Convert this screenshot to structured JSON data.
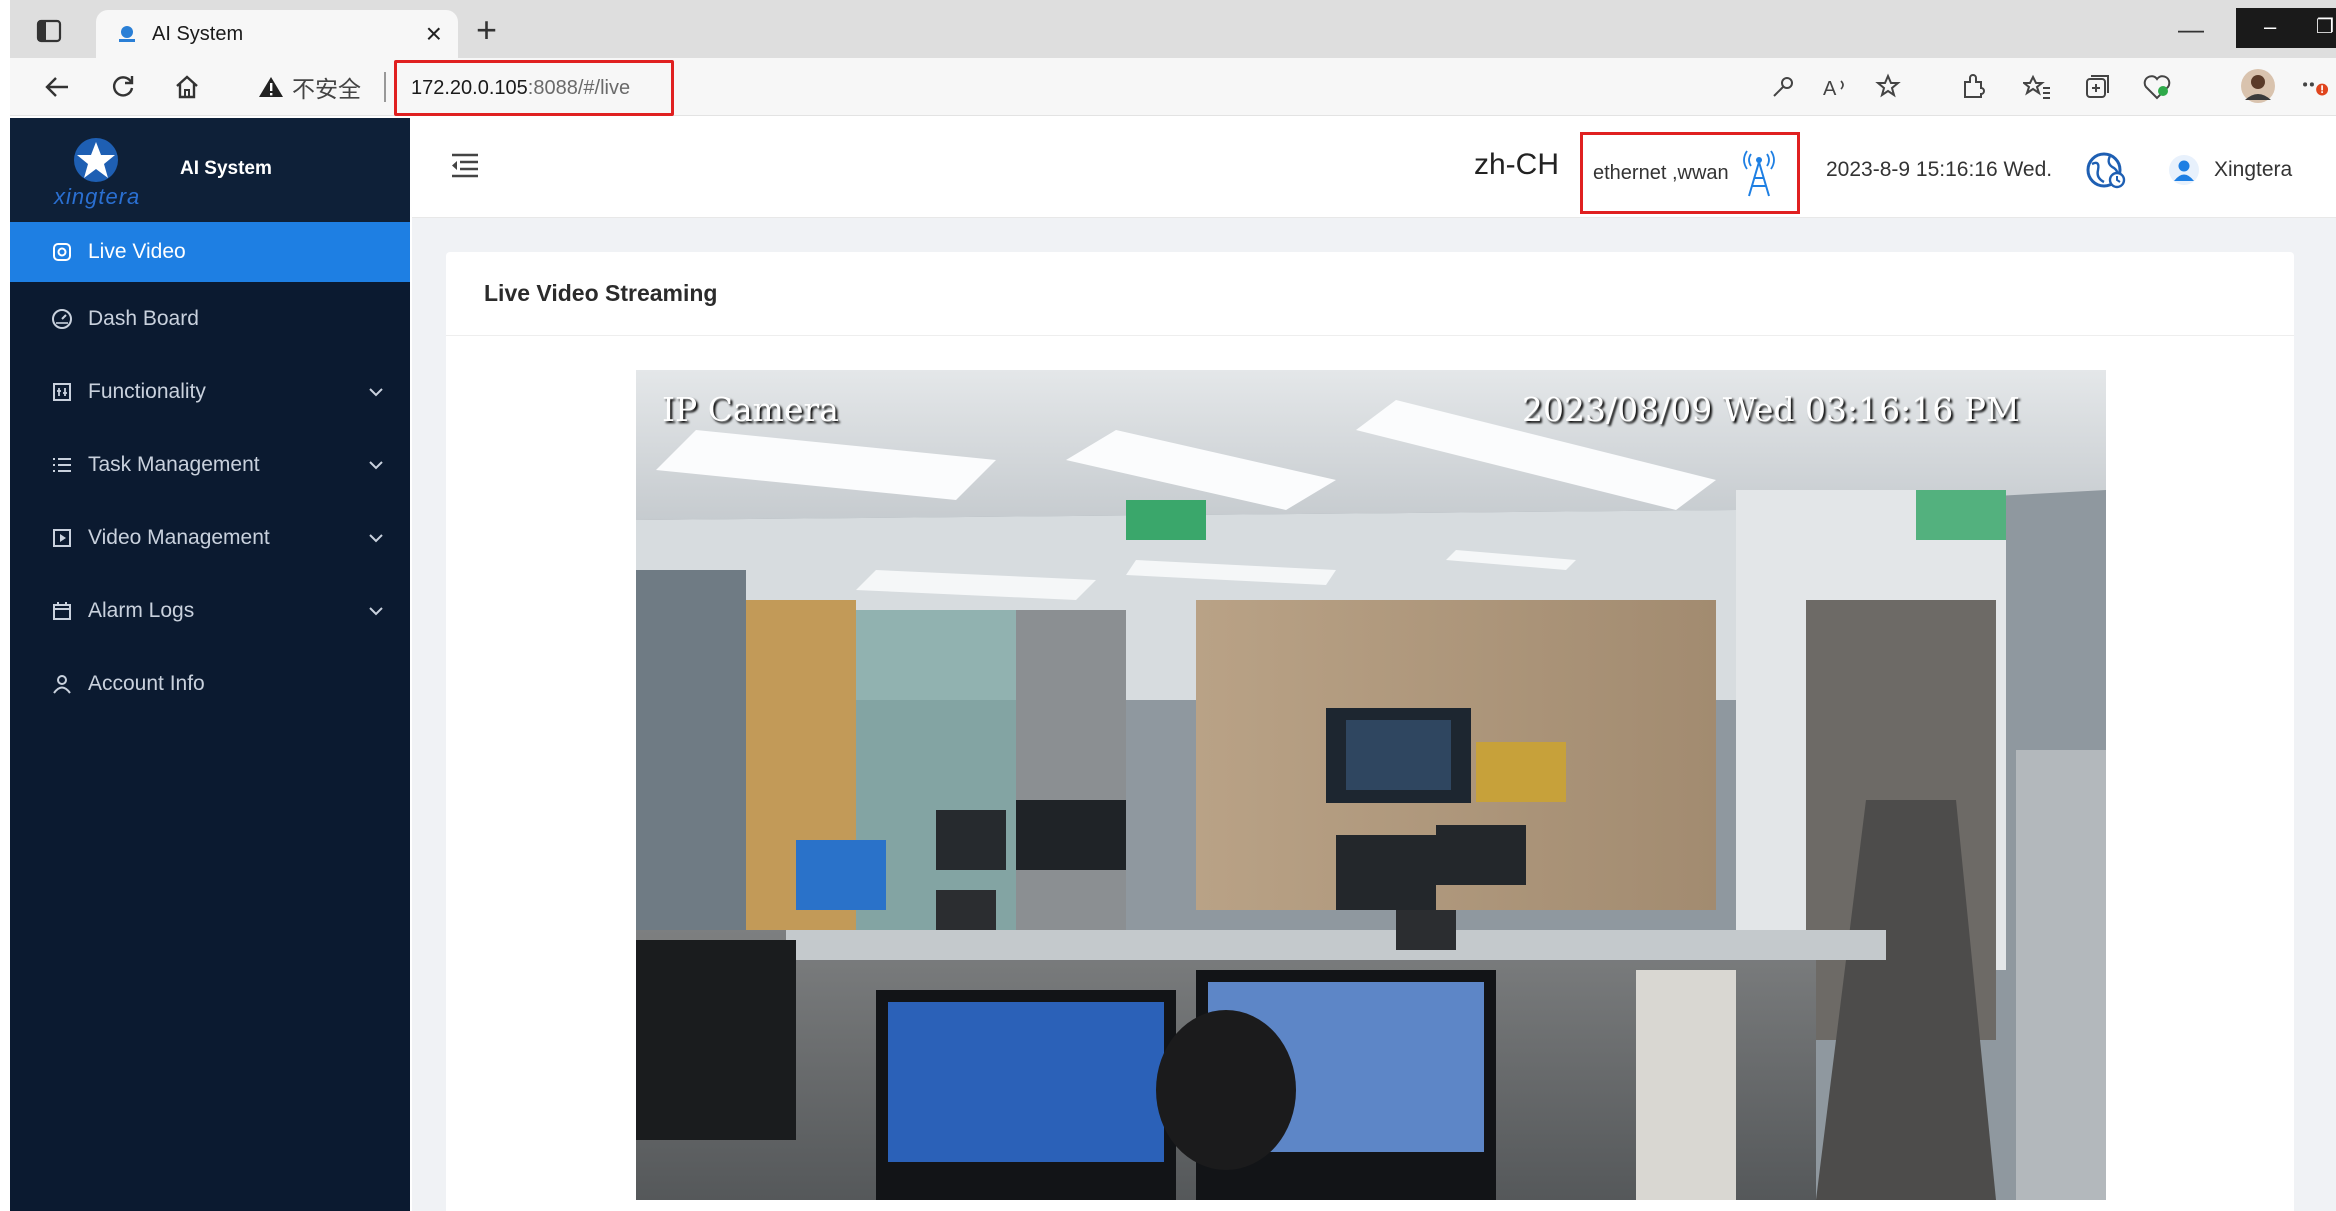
{
  "browser": {
    "tab_title": "AI System",
    "new_tab": "+",
    "close": "×",
    "security_warning": "不安全",
    "url_host": "172.20.0.105",
    "url_rest": ":8088/#/live"
  },
  "app": {
    "logo_text": "xingtera",
    "title": "AI System"
  },
  "menu": {
    "items": [
      {
        "label": "Live Video",
        "icon": "camera-icon",
        "active": true
      },
      {
        "label": "Dash Board",
        "icon": "dashboard-icon",
        "has_children": false
      },
      {
        "label": "Functionality",
        "icon": "functionality-icon",
        "has_children": true
      },
      {
        "label": "Task Management",
        "icon": "list-icon",
        "has_children": true
      },
      {
        "label": "Video Management",
        "icon": "video-icon",
        "has_children": true
      },
      {
        "label": "Alarm Logs",
        "icon": "calendar-icon",
        "has_children": true
      },
      {
        "label": "Account Info",
        "icon": "user-icon",
        "has_children": false
      }
    ]
  },
  "header": {
    "language": "zh-CH",
    "network": "ethernet ,wwan",
    "datetime": "2023-8-9 15:16:16 Wed.",
    "username": "Xingtera"
  },
  "content": {
    "title": "Live Video Streaming",
    "video_label_left": "IP Camera",
    "video_timestamp": "2023/08/09 Wed 03:16:16 PM"
  },
  "colors": {
    "sidebar_bg": "#0b1a30",
    "active_item": "#1e7fe3",
    "highlight_border": "#e02020"
  }
}
